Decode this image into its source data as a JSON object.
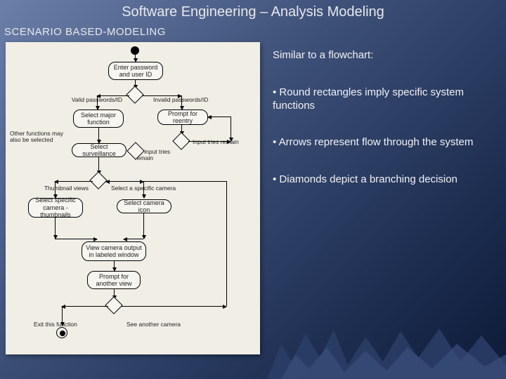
{
  "title": "Software Engineering – Analysis Modeling",
  "subtitle": "SCENARIO BASED-MODELING",
  "notes": {
    "intro": "Similar to a flowchart:",
    "b1": "• Round rectangles imply specific system functions",
    "b2": "• Arrows represent flow through the system",
    "b3": "• Diamonds depict a branching decision"
  },
  "diagram": {
    "n_enter": "Enter password and user ID",
    "lbl_valid": "Valid passwords/ID",
    "lbl_invalid": "Invalid passwords/ID",
    "n_selectmajor": "Select major function",
    "n_prompt_reentry": "Prompt for reentry",
    "note_other": "Other functions may also be selected",
    "lbl_tries_remain": "Input tries remain",
    "lbl_no_tries": "No input tries remain",
    "n_surveil": "Select surveillance",
    "lbl_thumb": "Thumbnail views",
    "lbl_selcam": "Select a specific camera",
    "n_selspec": "Select specific camera - thumbnails",
    "n_selicon": "Select camera icon",
    "n_view": "View camera output in labeled window",
    "n_promptview": "Prompt for another view",
    "lbl_exit": "Exit this function",
    "lbl_seeanother": "See another camera"
  }
}
